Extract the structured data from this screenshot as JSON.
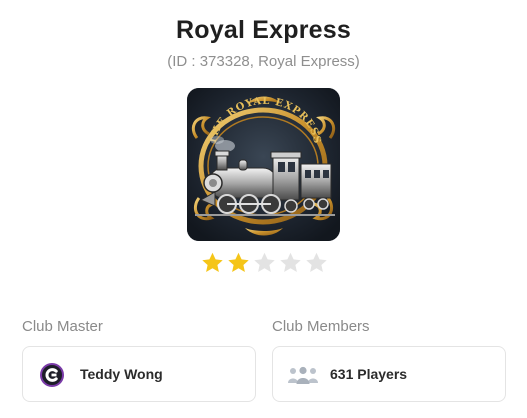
{
  "club": {
    "name": "Royal Express",
    "subtitle": "(ID : 373328, Royal Express)",
    "logo_text": "THE ROYAL EXPRESS",
    "rating": 2,
    "rating_max": 5
  },
  "club_master": {
    "label": "Club Master",
    "name": "Teddy Wong",
    "avatar_icon": "avatar-c-icon"
  },
  "club_members": {
    "label": "Club Members",
    "count_text": "631 Players",
    "icon": "people-group-icon"
  },
  "colors": {
    "star_filled": "#f5c518",
    "star_empty": "#e3e3e3",
    "title": "#1f1f1f",
    "muted": "#8f8f8f",
    "avatar_ring": "#6a2c91"
  }
}
